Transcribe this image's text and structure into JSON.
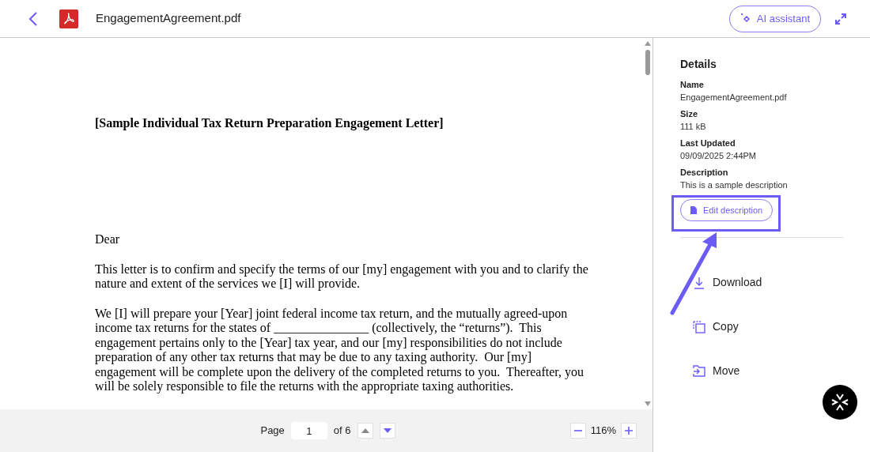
{
  "header": {
    "title": "EngagementAgreement.pdf",
    "ai_button": "AI assistant"
  },
  "document": {
    "heading": "[Sample Individual Tax Return Preparation Engagement Letter]",
    "paragraphs": [
      "Dear",
      "This letter is to confirm and specify the terms of our [my] engagement with you and to clarify the nature and extent of the services we [I] will provide.",
      "We [I] will prepare your [Year] joint federal income tax return, and the mutually agreed-upon income tax returns for the states of _______________ (collectively, the “returns”).  This engagement pertains only to the [Year] tax year, and our [my] responsibilities do not include preparation of any other tax returns that may be due to any taxing authority.  Our [my] engagement will be complete upon the delivery of the completed returns to you.  Thereafter, you will be solely responsible to file the returns with the appropriate taxing authorities."
    ]
  },
  "pager": {
    "label": "Page",
    "page": "1",
    "of": "of 6",
    "prev_disabled": true,
    "next_disabled": false,
    "zoom": "116%"
  },
  "details": {
    "title": "Details",
    "fields": [
      {
        "label": "Name",
        "value": "EngagementAgreement.pdf"
      },
      {
        "label": "Size",
        "value": "111 kB"
      },
      {
        "label": "Last Updated",
        "value": "09/09/2025 2:44PM"
      },
      {
        "label": "Description",
        "value": "This is a sample description"
      }
    ],
    "edit_button": "Edit description",
    "actions": [
      {
        "kind": "download",
        "label": "Download"
      },
      {
        "kind": "copy",
        "label": "Copy"
      },
      {
        "kind": "move",
        "label": "Move"
      }
    ]
  },
  "annotations": {
    "highlight_box": true,
    "arrow": true
  }
}
